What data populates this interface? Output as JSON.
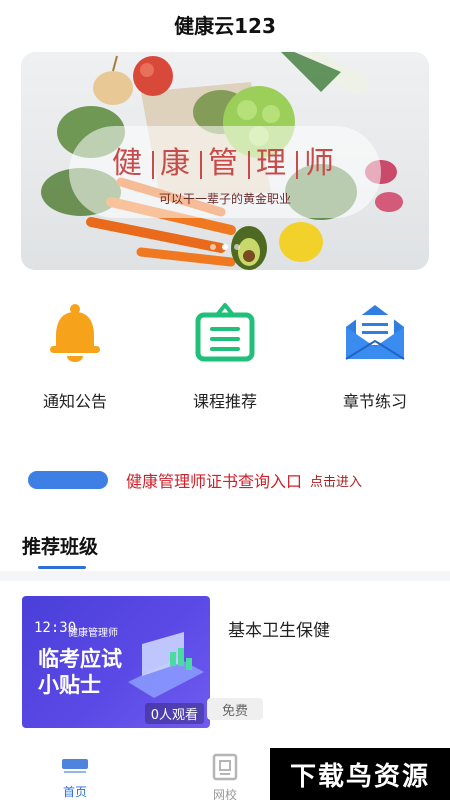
{
  "header": {
    "title": "健康云123"
  },
  "banner": {
    "title_chars": [
      "健",
      "康",
      "管",
      "理",
      "师"
    ],
    "subtitle": "可以干一辈子的黄金职业",
    "dots": 3,
    "active_dot": 1
  },
  "quick_actions": [
    {
      "label": "通知公告",
      "icon": "bell-icon",
      "color": "#f7a21b"
    },
    {
      "label": "课程推荐",
      "icon": "clipboard-icon",
      "color": "#21c07a"
    },
    {
      "label": "章节练习",
      "icon": "envelope-icon",
      "color": "#2f7fe0"
    }
  ],
  "cert_entry": {
    "text": "健康管理师证书查询入口",
    "link": "点击进入"
  },
  "section": {
    "title": "推荐班级"
  },
  "course": {
    "thumb_time": "12:30",
    "thumb_logo": "健康管理师",
    "thumb_line1": "临考应试",
    "thumb_line2": "小贴士",
    "views": "0人观看",
    "title": "基本卫生保健",
    "price_badge": "免费"
  },
  "tabbar": {
    "tabs": [
      {
        "label": "首页",
        "icon": "home-logo-icon",
        "active": true
      },
      {
        "label": "网校",
        "icon": "school-icon",
        "active": false
      }
    ]
  },
  "watermark": {
    "text": "下载鸟资源"
  },
  "colors": {
    "accent": "#2f6fd8",
    "cert_red": "#d0202a",
    "banner_title": "#c94a4a"
  }
}
